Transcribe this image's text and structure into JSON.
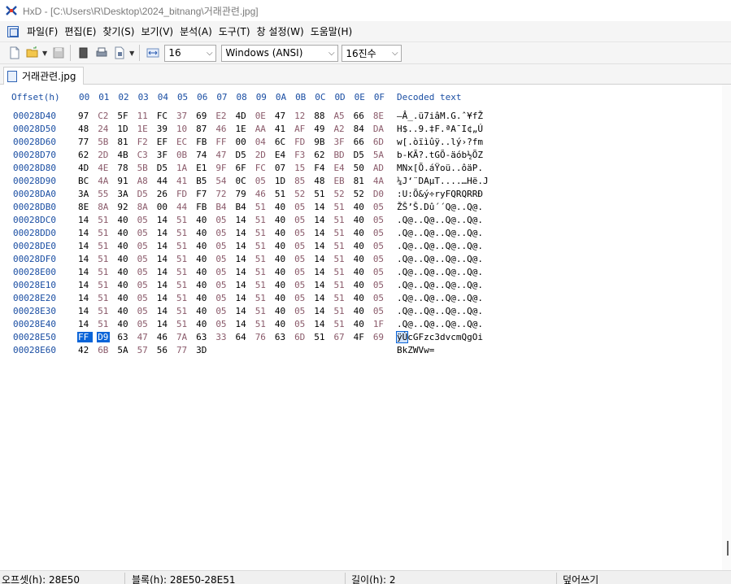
{
  "window": {
    "title": "HxD - [C:\\Users\\R\\Desktop\\2024_bitnang\\거래관련.jpg]"
  },
  "menu": [
    "파일(F)",
    "편집(E)",
    "찾기(S)",
    "보기(V)",
    "분석(A)",
    "도구(T)",
    "창 설정(W)",
    "도움말(H)"
  ],
  "toolbar": {
    "bytes_per_row": "16",
    "charset": "Windows (ANSI)",
    "offset_base": "16진수"
  },
  "tab": {
    "label": "거래관련.jpg"
  },
  "editor": {
    "header_offset": "Offset(h)",
    "header_columns": [
      "00",
      "01",
      "02",
      "03",
      "04",
      "05",
      "06",
      "07",
      "08",
      "09",
      "0A",
      "0B",
      "0C",
      "0D",
      "0E",
      "0F"
    ],
    "header_decoded": "Decoded text",
    "rows": [
      {
        "offset": "00028D40",
        "bytes": [
          "97",
          "C2",
          "5F",
          "11",
          "FC",
          "37",
          "69",
          "E2",
          "4D",
          "0E",
          "47",
          "12",
          "88",
          "A5",
          "66",
          "8E"
        ],
        "text": "—Â_.ü7iâM.G.ˆ¥fŽ"
      },
      {
        "offset": "00028D50",
        "bytes": [
          "48",
          "24",
          "1D",
          "1E",
          "39",
          "10",
          "87",
          "46",
          "1E",
          "AA",
          "41",
          "AF",
          "49",
          "A2",
          "84",
          "DA"
        ],
        "text": "H$..9.‡F.ªA¯I¢„Ú"
      },
      {
        "offset": "00028D60",
        "bytes": [
          "77",
          "5B",
          "81",
          "F2",
          "EF",
          "EC",
          "FB",
          "FF",
          "00",
          "04",
          "6C",
          "FD",
          "9B",
          "3F",
          "66",
          "6D"
        ],
        "text": "w[.òïìûÿ..lý›?fm"
      },
      {
        "offset": "00028D70",
        "bytes": [
          "62",
          "2D",
          "4B",
          "C3",
          "3F",
          "0B",
          "74",
          "47",
          "D5",
          "2D",
          "E4",
          "F3",
          "62",
          "BD",
          "D5",
          "5A"
        ],
        "text": "b-KÃ?.tGÕ-äób½ÕZ"
      },
      {
        "offset": "00028D80",
        "bytes": [
          "4D",
          "4E",
          "78",
          "5B",
          "D5",
          "1A",
          "E1",
          "9F",
          "6F",
          "FC",
          "07",
          "15",
          "F4",
          "E4",
          "50",
          "AD"
        ],
        "text": "MNx[Õ.áŸoü..ôäP."
      },
      {
        "offset": "00028D90",
        "bytes": [
          "BC",
          "4A",
          "91",
          "A8",
          "44",
          "41",
          "B5",
          "54",
          "0C",
          "05",
          "1D",
          "85",
          "48",
          "EB",
          "81",
          "4A"
        ],
        "text": "¼J‘¨DAµT....…Hë.J"
      },
      {
        "offset": "00028DA0",
        "bytes": [
          "3A",
          "55",
          "3A",
          "D5",
          "26",
          "FD",
          "F7",
          "72",
          "79",
          "46",
          "51",
          "52",
          "51",
          "52",
          "52",
          "D0"
        ],
        "text": ":U:Õ&ý÷ryFQRQRRÐ"
      },
      {
        "offset": "00028DB0",
        "bytes": [
          "8E",
          "8A",
          "92",
          "8A",
          "00",
          "44",
          "FB",
          "B4",
          "B4",
          "51",
          "40",
          "05",
          "14",
          "51",
          "40",
          "05"
        ],
        "text": "ŽŠ’Š.Dû´´Q@..Q@."
      },
      {
        "offset": "00028DC0",
        "bytes": [
          "14",
          "51",
          "40",
          "05",
          "14",
          "51",
          "40",
          "05",
          "14",
          "51",
          "40",
          "05",
          "14",
          "51",
          "40",
          "05"
        ],
        "text": ".Q@..Q@..Q@..Q@."
      },
      {
        "offset": "00028DD0",
        "bytes": [
          "14",
          "51",
          "40",
          "05",
          "14",
          "51",
          "40",
          "05",
          "14",
          "51",
          "40",
          "05",
          "14",
          "51",
          "40",
          "05"
        ],
        "text": ".Q@..Q@..Q@..Q@."
      },
      {
        "offset": "00028DE0",
        "bytes": [
          "14",
          "51",
          "40",
          "05",
          "14",
          "51",
          "40",
          "05",
          "14",
          "51",
          "40",
          "05",
          "14",
          "51",
          "40",
          "05"
        ],
        "text": ".Q@..Q@..Q@..Q@."
      },
      {
        "offset": "00028DF0",
        "bytes": [
          "14",
          "51",
          "40",
          "05",
          "14",
          "51",
          "40",
          "05",
          "14",
          "51",
          "40",
          "05",
          "14",
          "51",
          "40",
          "05"
        ],
        "text": ".Q@..Q@..Q@..Q@."
      },
      {
        "offset": "00028E00",
        "bytes": [
          "14",
          "51",
          "40",
          "05",
          "14",
          "51",
          "40",
          "05",
          "14",
          "51",
          "40",
          "05",
          "14",
          "51",
          "40",
          "05"
        ],
        "text": ".Q@..Q@..Q@..Q@."
      },
      {
        "offset": "00028E10",
        "bytes": [
          "14",
          "51",
          "40",
          "05",
          "14",
          "51",
          "40",
          "05",
          "14",
          "51",
          "40",
          "05",
          "14",
          "51",
          "40",
          "05"
        ],
        "text": ".Q@..Q@..Q@..Q@."
      },
      {
        "offset": "00028E20",
        "bytes": [
          "14",
          "51",
          "40",
          "05",
          "14",
          "51",
          "40",
          "05",
          "14",
          "51",
          "40",
          "05",
          "14",
          "51",
          "40",
          "05"
        ],
        "text": ".Q@..Q@..Q@..Q@."
      },
      {
        "offset": "00028E30",
        "bytes": [
          "14",
          "51",
          "40",
          "05",
          "14",
          "51",
          "40",
          "05",
          "14",
          "51",
          "40",
          "05",
          "14",
          "51",
          "40",
          "05"
        ],
        "text": ".Q@..Q@..Q@..Q@."
      },
      {
        "offset": "00028E40",
        "bytes": [
          "14",
          "51",
          "40",
          "05",
          "14",
          "51",
          "40",
          "05",
          "14",
          "51",
          "40",
          "05",
          "14",
          "51",
          "40",
          "1F"
        ],
        "text": ".Q@..Q@..Q@..Q@."
      },
      {
        "offset": "00028E50",
        "bytes": [
          "FF",
          "D9",
          "63",
          "47",
          "46",
          "7A",
          "63",
          "33",
          "64",
          "76",
          "63",
          "6D",
          "51",
          "67",
          "4F",
          "69"
        ],
        "text": "ÿÙcGFzc3dvcmQgOi",
        "selected_bytes": [
          0,
          1
        ],
        "selected_text": "ÿÙ"
      },
      {
        "offset": "00028E60",
        "bytes": [
          "42",
          "6B",
          "5A",
          "57",
          "56",
          "77",
          "3D"
        ],
        "text": "BkZWVw="
      }
    ]
  },
  "status": {
    "offset": "오프셋(h): 28E50",
    "block": "블록(h): 28E50-28E51",
    "length": "길이(h): 2",
    "mode": "덮어쓰기"
  }
}
